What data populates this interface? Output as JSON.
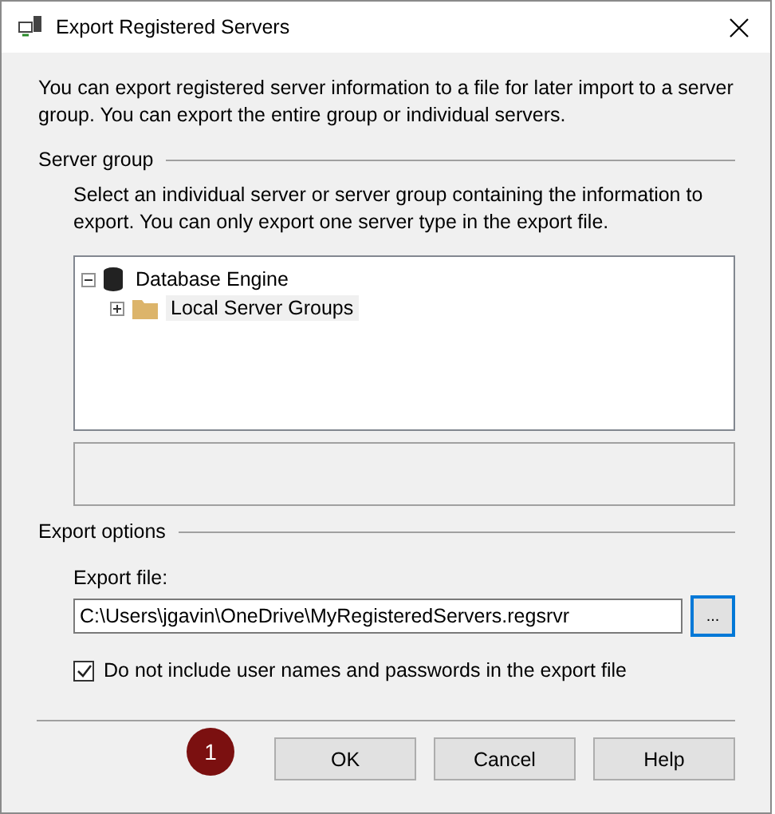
{
  "window": {
    "title": "Export Registered Servers"
  },
  "intro": "You can export registered server information to a file for later import to a server group. You can export the entire group or individual servers.",
  "server_group": {
    "heading": "Server group",
    "description": "Select an individual server or server group containing the information to export. You can only export one server type in the export file.",
    "tree": [
      {
        "label": "Database Engine",
        "kind": "database",
        "expanded": true,
        "selected": false,
        "children": [
          {
            "label": "Local Server Groups",
            "kind": "folder",
            "expanded": false,
            "selected": true
          }
        ]
      }
    ]
  },
  "export_options": {
    "heading": "Export options",
    "file_label": "Export file:",
    "file_value": "C:\\Users\\jgavin\\OneDrive\\MyRegisteredServers.regsrvr",
    "browse_label": "...",
    "exclude_credentials": {
      "label": "Do not include user names and passwords in the export file",
      "checked": true
    }
  },
  "callout": "1",
  "buttons": [
    "OK",
    "Cancel",
    "Help"
  ]
}
